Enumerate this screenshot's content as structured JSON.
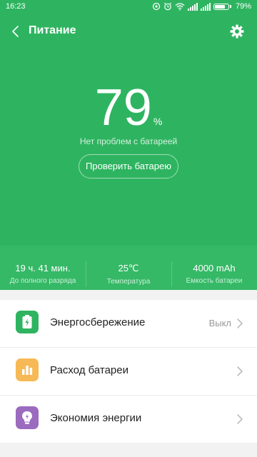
{
  "status_bar": {
    "time": "16:23",
    "battery_pct": "79%",
    "battery_level": 0.79
  },
  "header": {
    "title": "Питание"
  },
  "battery": {
    "percent_value": "79",
    "percent_sign": "%",
    "status_text": "Нет проблем с батареей",
    "check_button_label": "Проверить батарею"
  },
  "stats": [
    {
      "value": "19 ч. 41 мин.",
      "label": "До полного разряда"
    },
    {
      "value": "25℃",
      "label": "Температура"
    },
    {
      "value": "4000 mAh",
      "label": "Емкость батареи"
    }
  ],
  "menu": [
    {
      "label": "Энергосбережение",
      "value": "Выкл",
      "icon": "battery-saver-icon",
      "icon_color": "#2eb460"
    },
    {
      "label": "Расход батареи",
      "value": "",
      "icon": "bar-chart-icon",
      "icon_color": "#f7b955"
    },
    {
      "label": "Экономия энергии",
      "value": "",
      "icon": "lightbulb-icon",
      "icon_color": "#9b6bbf"
    }
  ],
  "colors": {
    "primary_green": "#2eb460",
    "stats_green": "#35b966",
    "background": "#f2f2f2"
  }
}
